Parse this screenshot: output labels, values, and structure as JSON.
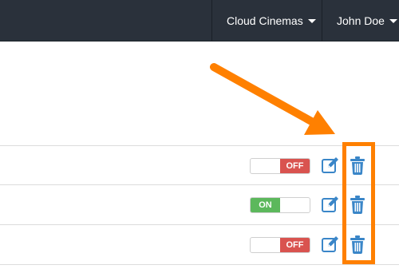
{
  "header": {
    "org_menu_label": "Cloud Cinemas",
    "user_menu_label": "John Doe"
  },
  "rows": [
    {
      "toggle_state": "OFF"
    },
    {
      "toggle_state": "ON"
    },
    {
      "toggle_state": "OFF"
    }
  ],
  "colors": {
    "topbar": "#2a313b",
    "toggle_off": "#d9534f",
    "toggle_on": "#5cb85c",
    "action_icons": "#3a86c8",
    "annotation": "#ff8000"
  },
  "icons": {
    "edit": "edit-icon",
    "delete": "trash-icon",
    "menu_caret": "caret-down-icon"
  }
}
